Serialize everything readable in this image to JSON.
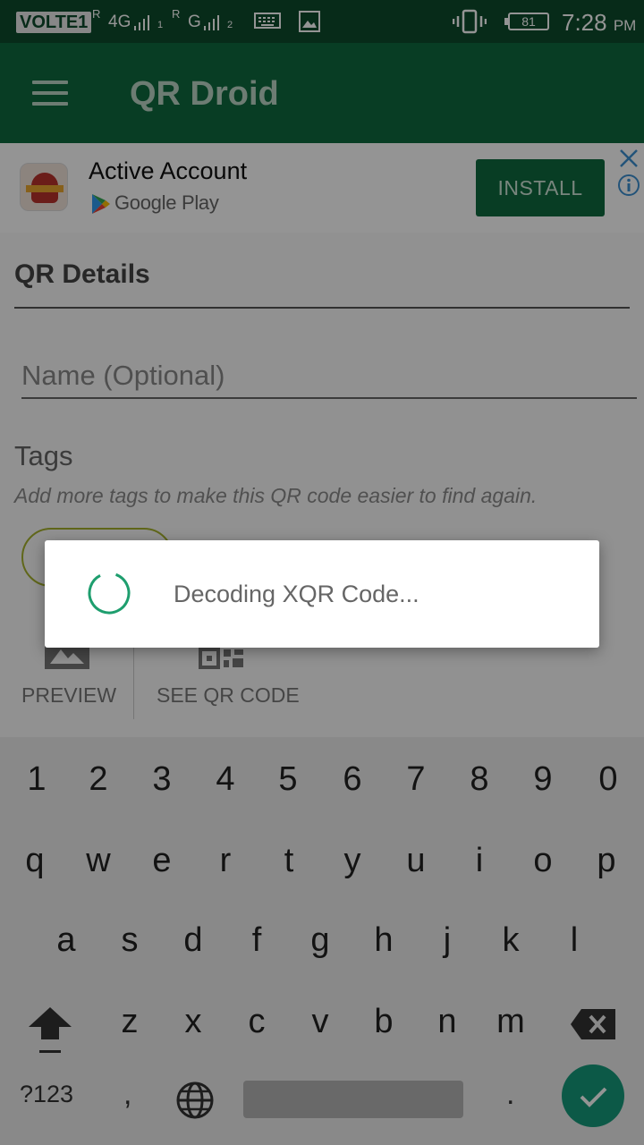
{
  "status_bar": {
    "carrier_badge": "VOLTE1",
    "sim1_roaming": "R",
    "sim1_network": "4G",
    "sim1_slot": "1",
    "sim2_roaming": "R",
    "sim2_network": "G",
    "sim2_slot": "2",
    "battery": "81",
    "time": "7:28",
    "ampm": "PM",
    "icons": [
      "keyboard-icon",
      "image-icon",
      "vibrate-icon"
    ]
  },
  "app_bar": {
    "title": "QR Droid",
    "menu_icon": "hamburger-menu-icon"
  },
  "ad": {
    "title": "Active Account",
    "store": "Google Play",
    "install_label": "INSTALL"
  },
  "form": {
    "section_title": "QR Details",
    "name_placeholder": "Name (Optional)",
    "name_value": "",
    "tags_label": "Tags",
    "tags_hint": "Add more tags to make this QR code easier to find again."
  },
  "actions": {
    "preview_label": "PREVIEW",
    "see_qr_label": "SEE QR CODE"
  },
  "dialog": {
    "message": "Decoding XQR Code..."
  },
  "keyboard": {
    "row_numbers": [
      "1",
      "2",
      "3",
      "4",
      "5",
      "6",
      "7",
      "8",
      "9",
      "0"
    ],
    "row_top": [
      "q",
      "w",
      "e",
      "r",
      "t",
      "y",
      "u",
      "i",
      "o",
      "p"
    ],
    "row_middle": [
      "a",
      "s",
      "d",
      "f",
      "g",
      "h",
      "j",
      "k",
      "l"
    ],
    "row_bottom": [
      "z",
      "x",
      "c",
      "v",
      "b",
      "n",
      "m"
    ],
    "symbols_label": "?123",
    "comma_label": ",",
    "period_label": "."
  },
  "colors": {
    "status_bar": "#0d4a2c",
    "app_bar": "#0f6a3e",
    "accent": "#159a7a",
    "chip_border": "#a5b12d"
  }
}
